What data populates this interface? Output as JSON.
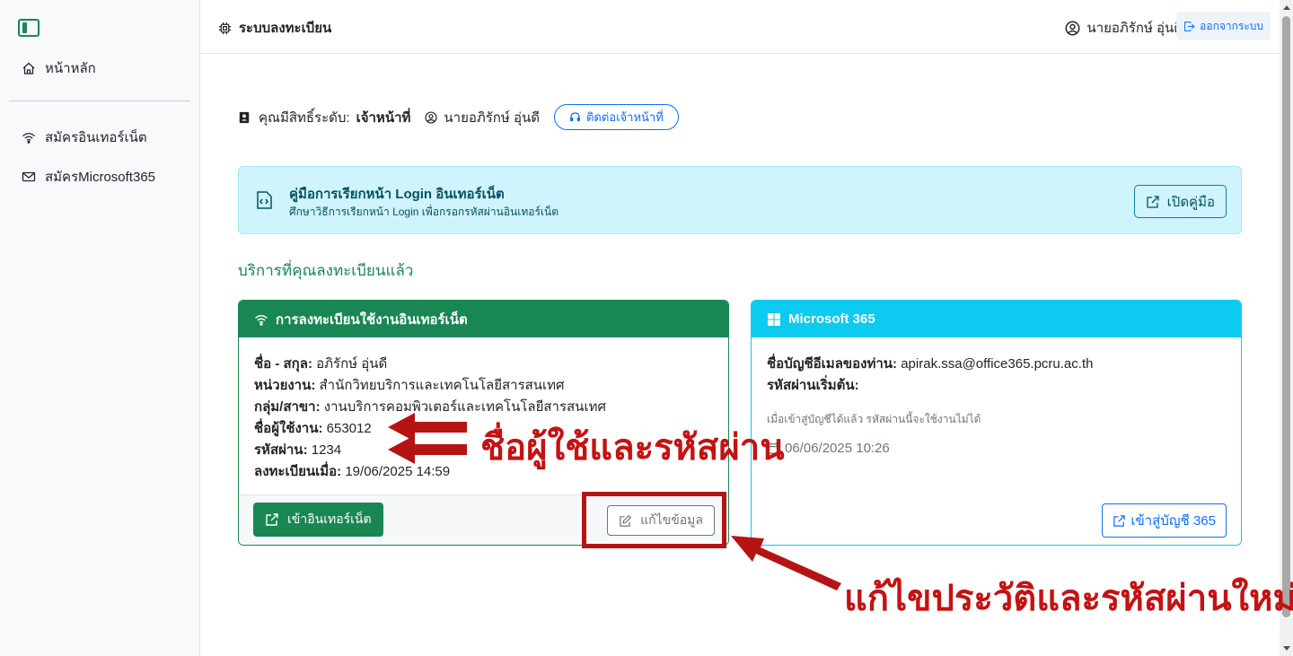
{
  "sidebar": {
    "items": [
      {
        "label": "หน้าหลัก",
        "icon": "home-icon"
      },
      {
        "label": "สมัครอินเทอร์เน็ต",
        "icon": "wifi-icon"
      },
      {
        "label": "สมัครMicrosoft365",
        "icon": "envelope-icon"
      }
    ]
  },
  "header": {
    "title": "ระบบลงทะเบียน",
    "user": "นายอภิรักษ์ อุ่นดี",
    "logout": "ออกจากระบบ"
  },
  "info": {
    "role_label": "คุณมีสิทธิ์ระดับ:",
    "role": "เจ้าหน้าที่",
    "user": "นายอภิรักษ์ อุ่นดี",
    "contact": "ติดต่อเจ้าหน้าที่"
  },
  "guide": {
    "title": "คู่มือการเรียกหน้า Login อินเทอร์เน็ต",
    "subtitle": "ศึกษาวิธีการเรียกหน้า Login เพื่อกรอกรหัสผ่านอินเทอร์เน็ต",
    "button": "เปิดคู่มือ"
  },
  "section_title": "บริการที่คุณลงทะเบียนแล้ว",
  "internet_card": {
    "header": "การลงทะเบียนใช้งานอินเทอร์เน็ต",
    "fields": [
      {
        "label": "ชื่อ - สกุล:",
        "value": "อภิรักษ์ อุ่นดี"
      },
      {
        "label": "หน่วยงาน:",
        "value": "สำนักวิทยบริการและเทคโนโลยีสารสนเทศ"
      },
      {
        "label": "กลุ่ม/สาขา:",
        "value": "งานบริการคอมพิวเตอร์และเทคโนโลยีสารสนเทศ"
      },
      {
        "label": "ชื่อผู้ใช้งาน:",
        "value": "653012"
      },
      {
        "label": "รหัสผ่าน:",
        "value": "1234"
      },
      {
        "label": "ลงทะเบียนเมื่อ:",
        "value": "19/06/2025 14:59"
      }
    ],
    "enter_button": "เข้าอินเทอร์เน็ต",
    "edit_button": "แก้ไขข้อมูล"
  },
  "ms_card": {
    "header": "Microsoft 365",
    "email_label": "ชื่อบัญชีอีเมลของท่าน:",
    "email": "apirak.ssa@office365.pcru.ac.th",
    "password_label": "รหัสผ่านเริ่มต้น:",
    "note": "เมื่อเข้าสู่บัญชีได้แล้ว รหัสผ่านนี้จะใช้งานไม่ได้",
    "date": "06/06/2025 10:26",
    "button": "เข้าสู่บัญชี 365"
  },
  "annotations": {
    "credentials_note": "ชื่อผู้ใช้และรหัสผ่าน",
    "edit_note": "แก้ไขประวัติและรหัสผ่านใหม่",
    "color": "#c41212"
  },
  "colors": {
    "primary": "#0d6efd",
    "success": "#198754",
    "info": "#0dcaf0"
  }
}
